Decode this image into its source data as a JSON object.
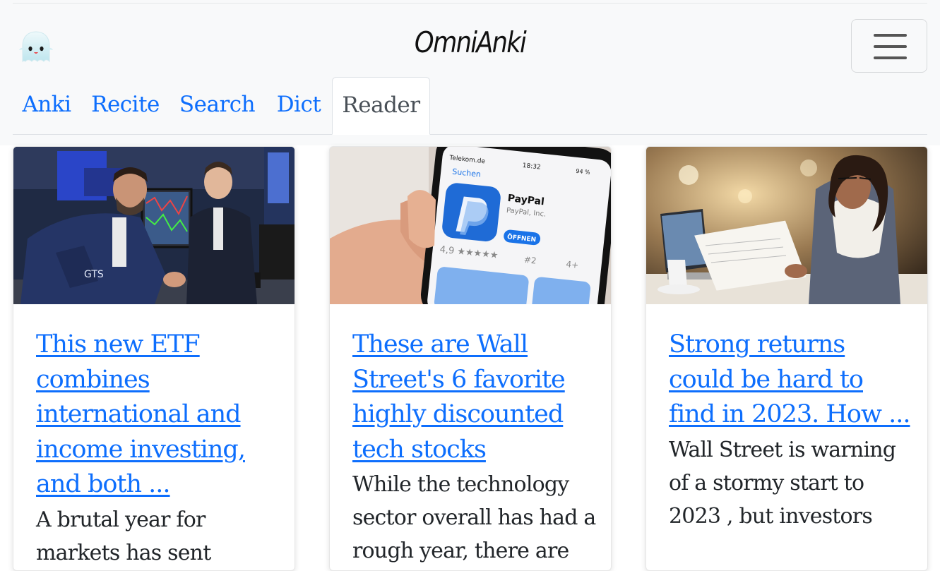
{
  "app": {
    "brand": "OmniAnki",
    "logo_icon": "ghost-icon",
    "menu_icon": "hamburger-icon"
  },
  "tabs": [
    {
      "label": "Anki",
      "active": false
    },
    {
      "label": "Recite",
      "active": false
    },
    {
      "label": "Search",
      "active": false
    },
    {
      "label": "Dict",
      "active": false
    },
    {
      "label": "Reader",
      "active": true
    }
  ],
  "articles": [
    {
      "title": "This new ETF combines international and income investing, and both ...",
      "summary": "A brutal year for markets has sent",
      "image": "stock-exchange-traders-photo"
    },
    {
      "title": "These are Wall Street's 6 favorite highly discounted tech stocks",
      "summary": "While the technology sector overall has had a rough year, there are",
      "image": "paypal-app-phone-photo",
      "image_text": {
        "carrier": "Telekom.de",
        "time": "18:32",
        "battery": "94 %",
        "back": "Suchen",
        "app_name": "PayPal",
        "developer": "PayPal, Inc.",
        "button": "ÖFFNEN",
        "rating": "4,9 ★★★★★",
        "rank": "#2",
        "age": "4+"
      }
    },
    {
      "title": "Strong returns could be hard to find in 2023. How ...",
      "summary": "Wall Street is warning of a stormy start to 2023 , but investors",
      "image": "woman-reading-document-photo"
    }
  ],
  "colors": {
    "link": "#0d6efd",
    "navbar_bg": "#f8f9fa",
    "active_tab_text": "#495057",
    "body_text": "#212529"
  }
}
